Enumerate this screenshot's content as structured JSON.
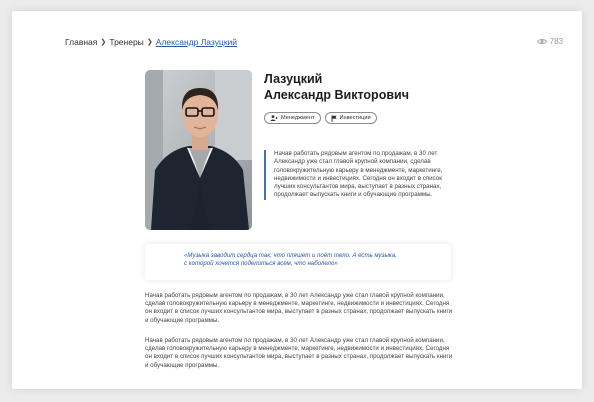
{
  "breadcrumb": {
    "items": [
      "Главная",
      "Тренеры",
      "Александр Лазуцкий"
    ]
  },
  "views": {
    "count": "783",
    "icon": "eye-icon"
  },
  "trainer": {
    "surname": "Лазуцкий",
    "name": "Александр Викторович",
    "tags": [
      {
        "label": "Менеджмент",
        "icon": "person-icon"
      },
      {
        "label": "Инвестиции",
        "icon": "flag-icon"
      }
    ],
    "bio": "Начав работать рядовым агентом по продажам, в 30 лет Александр уже стал главой крупной компании, сделав головокружительную карьеру в менеджменте, маркетинге, недвижимости и инвестициях. Сегодня он входит в список лучших консультантов мира, выступает в разных странах, продолжает выпускать книги и обучающие программы.",
    "quote_line1": "«Музыка заводит сердца так, что пляшет и поёт тело. А есть музыка,",
    "quote_line2": "с которой хочется поделиться всем, что наболело»",
    "paragraphs": [
      "Начав работать рядовым агентом по продажам, в 30 лет Александр уже стал главой крупной компании, сделав головокружительную карьеру в менеджменте, маркетинге, недвижимости и инвестициях. Сегодня он входит в список лучших консультантов мира, выступает в разных странах, продолжает выпускать книги и обучающие программы.",
      "Начав работать рядовым агентом по продажам, в 30 лет Александр уже стал главой крупной компании, сделав головокружительную карьеру в менеджменте, маркетинге, недвижимости и инвестициях. Сегодня он входит в список лучших консультантов мира, выступает в разных странах, продолжает выпускать книги и обучающие программы."
    ]
  },
  "colors": {
    "accent": "#3f73c2",
    "link": "#2b5aa8",
    "quote_text": "#2a55a5",
    "muted": "#9a9a9a"
  }
}
